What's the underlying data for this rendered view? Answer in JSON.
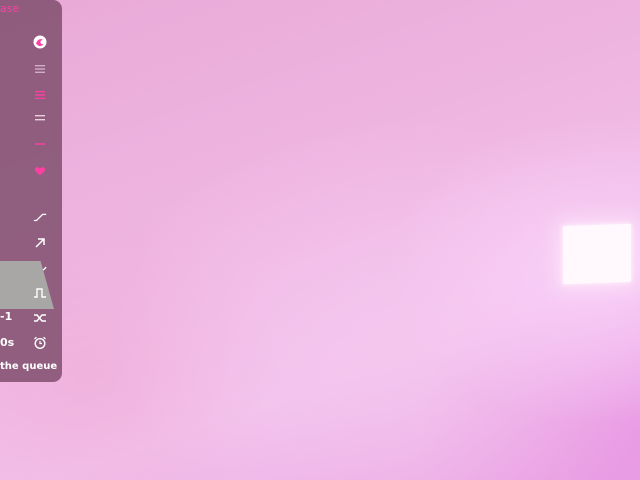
{
  "panel": {
    "top_text": "ase",
    "value_count": "-1",
    "value_time": "0s",
    "queue_text": "the queue",
    "icons": [
      "logo-icon",
      "menu-icon",
      "pink-list-icon",
      "list-icon",
      "pink-minus-icon",
      "heart-icon",
      "ramp-icon",
      "arrow-up-right-icon",
      "wave-icon",
      "pulse-icon",
      "shuffle-icon",
      "alarm-icon"
    ]
  },
  "colors": {
    "accent": "#ff3fa2",
    "panel_bg": "#7e4e6c",
    "icon_white": "#ffffff"
  }
}
